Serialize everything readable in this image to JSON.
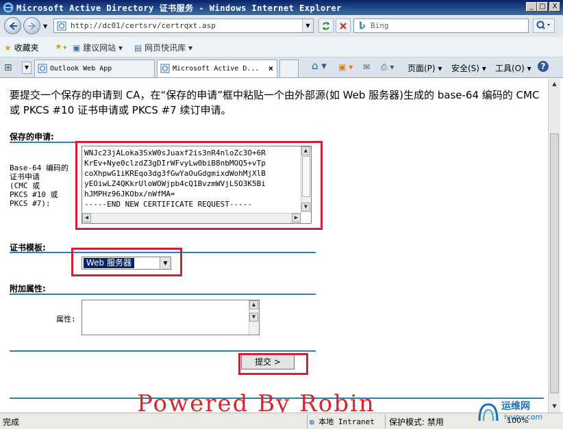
{
  "window": {
    "title": "Microsoft Active Directory 证书服务 - Windows Internet Explorer",
    "minimize": "_",
    "maximize": "□",
    "close": "X"
  },
  "addressbar": {
    "url": "http://dc01/certsrv/certrqxt.asp",
    "search_placeholder": "Bing"
  },
  "favorites": {
    "favorites_label": "收藏夹",
    "suggested_sites": "建议网站 ▾",
    "web_slice": "网页快讯库 ▾"
  },
  "tabs": [
    {
      "label": "Outlook Web App"
    },
    {
      "label": "Microsoft Active D..."
    }
  ],
  "commandbar": {
    "page": "页面(P) ▾",
    "safety": "安全(S) ▾",
    "tools": "工具(O) ▾",
    "help": "?"
  },
  "page": {
    "intro": "要提交一个保存的申请到 CA，在“保存的申请”框中粘贴一个由外部源(如 Web 服务器)生成的 base-64 编码的 CMC 或 PKCS #10 证书申请或 PKCS #7 续订申请。",
    "saved_request_heading": "保存的申请:",
    "base64_label_l1": "Base-64 编码的",
    "base64_label_l2": "证书申请",
    "base64_label_l3": "(CMC 或",
    "base64_label_l4": "PKCS #10 或",
    "base64_label_l5": "PKCS #7):",
    "request_text": "WNJc23jALoka3SxW0sJuaxf2is3nR4nloZc3O+6R\nKrEv+Nye0clzdZ3gDIrWFvyLw0biB8nbMOQ5+vTp\ncoXhpwG1iKREqo3dg3fGwYaOuGdgmixdWohMjXlB\nyEOiwLZ4QKkrUloWOWjpb4cQ1BvzmWVjLSO3K5Bi\nhJMPHz96JKObx/nWfMA=\n-----END NEW CERTIFICATE REQUEST-----",
    "template_heading": "证书模板:",
    "template_selected": "Web 服务器",
    "attributes_heading": "附加属性:",
    "attributes_label": "属性:",
    "attributes_value": "",
    "submit_label": "提交 >",
    "watermark_text": "Powered By Robin"
  },
  "statusbar": {
    "status": "完成",
    "zone": "本地 Intranet",
    "protected_mode": "保护模式: 禁用",
    "zoom": "100%"
  },
  "logo_watermark": {
    "line1": "运维网",
    "line2": "iyunv.com"
  },
  "colors": {
    "highlight_box": "#d51f35",
    "section_rule": "#2f7ea8",
    "powered_text": "#d6262c"
  }
}
